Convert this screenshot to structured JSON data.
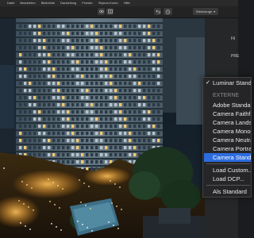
{
  "menubar": {
    "items": [
      "Datei",
      "Bearbeiten",
      "Bibliothek",
      "Darstellung",
      "Fenster",
      "Skylum-Konto",
      "Hilfe"
    ]
  },
  "toolbar": {
    "undo_icon": "undo-arrow-icon",
    "history_icon": "clock-history-icon",
    "preset_label": "Werkzeuge"
  },
  "right_panel": {
    "label_top": "Fil",
    "label_2": "PRE"
  },
  "dropdown": {
    "checked_item": "Luminar Standard",
    "section_header": "EXTERNE",
    "items": [
      "Adobe Standard",
      "Camera Faithful",
      "Camera Landscape",
      "Camera Monochrome",
      "Camera Neutral",
      "Camera Portrait",
      "Camera Standard"
    ],
    "selected_index": 6,
    "bottom_items": [
      "Load Custom...",
      "Load DCP..."
    ],
    "last_item": "Als Standard"
  },
  "colors": {
    "selection": "#2d6cdf",
    "menubar": "#2b2b2b",
    "panel": "#262728"
  }
}
